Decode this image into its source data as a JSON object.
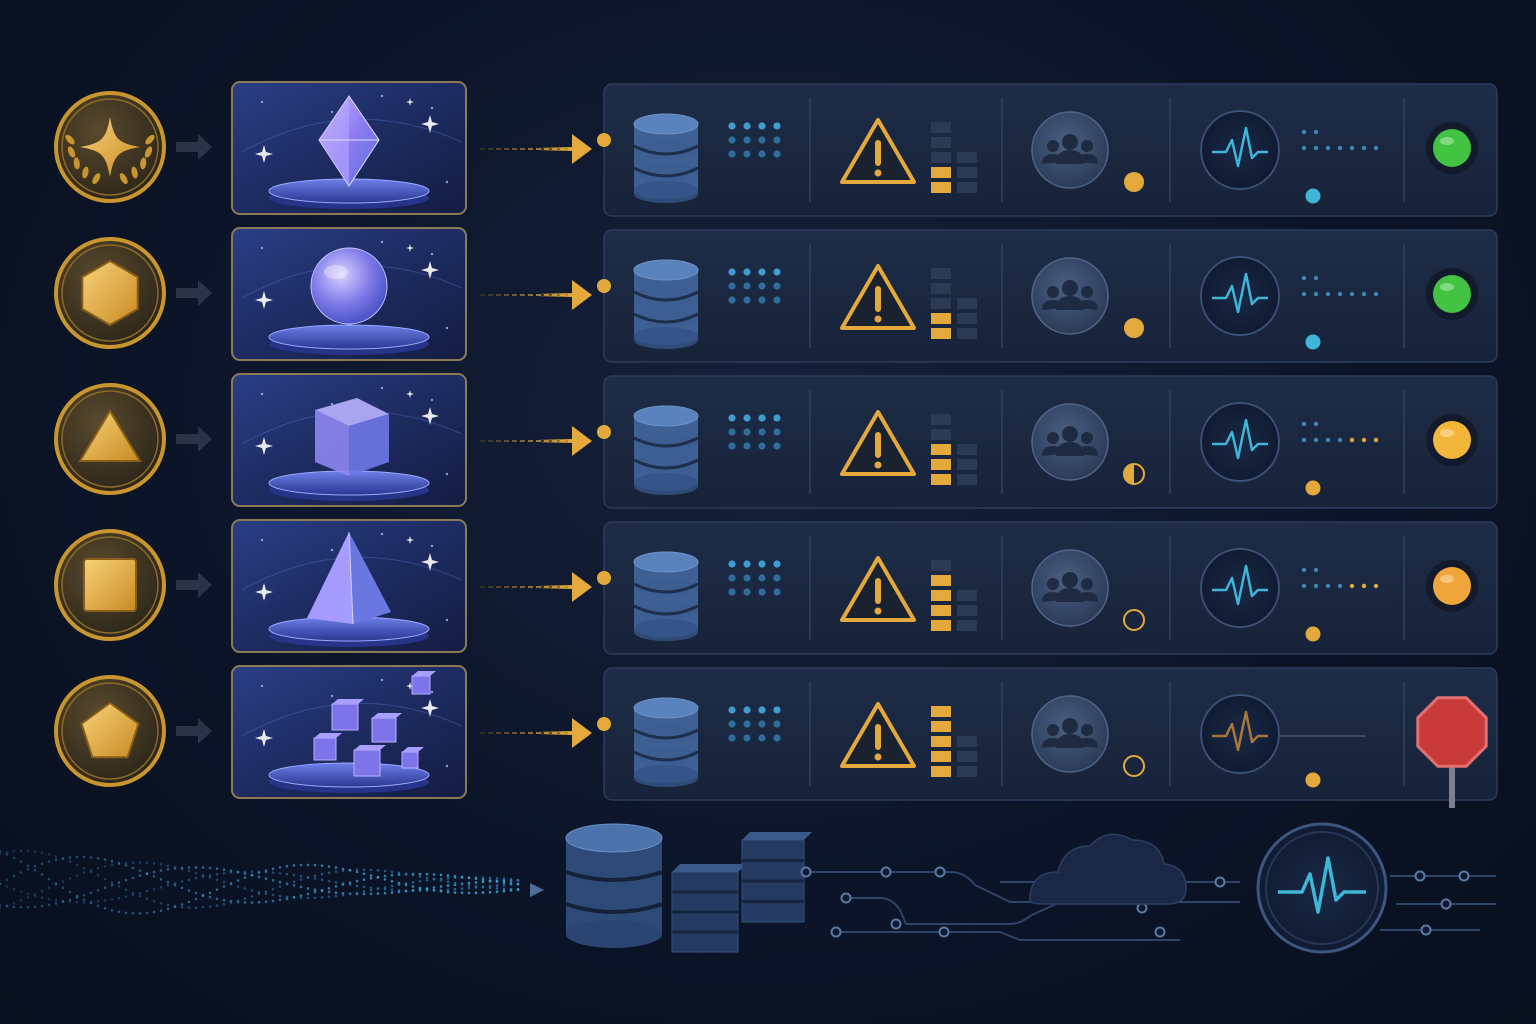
{
  "colors": {
    "background": "#0c1528",
    "panel": "#1a2740",
    "panel_border": "#2d3d5c",
    "gold": "#e3a93c",
    "gold_light": "#f4c766",
    "blue_icon": "#4b74a8",
    "cyan": "#3fb6d8",
    "green": "#42c342",
    "yellow": "#f2b73a",
    "orange": "#f0a53a",
    "red": "#c83a3a"
  },
  "rows": [
    {
      "badge": "four-point-star-badge",
      "visual": "octahedron-crystal",
      "level_bars": 2,
      "group_indicator": "filled",
      "signal": "normal",
      "dots_accent": "cyan",
      "status": "green"
    },
    {
      "badge": "hexagon-badge",
      "visual": "sphere",
      "level_bars": 2,
      "group_indicator": "filled",
      "signal": "normal",
      "dots_accent": "cyan",
      "status": "green"
    },
    {
      "badge": "triangle-badge",
      "visual": "cube",
      "level_bars": 3,
      "group_indicator": "half",
      "signal": "normal",
      "dots_accent": "orange",
      "status": "yellow"
    },
    {
      "badge": "square-badge",
      "visual": "pyramid",
      "level_bars": 4,
      "group_indicator": "empty",
      "signal": "normal",
      "dots_accent": "orange",
      "status": "orange"
    },
    {
      "badge": "pentagon-badge",
      "visual": "cube-cluster",
      "level_bars": 5,
      "group_indicator": "empty",
      "signal": "weak",
      "dots_accent": "orange",
      "status": "stop-sign"
    }
  ],
  "footer": {
    "icons": [
      "data-wave-icon",
      "database-icon",
      "server-stack-icon",
      "circuit-lines-icon",
      "cloud-icon",
      "heartbeat-monitor-icon"
    ]
  }
}
